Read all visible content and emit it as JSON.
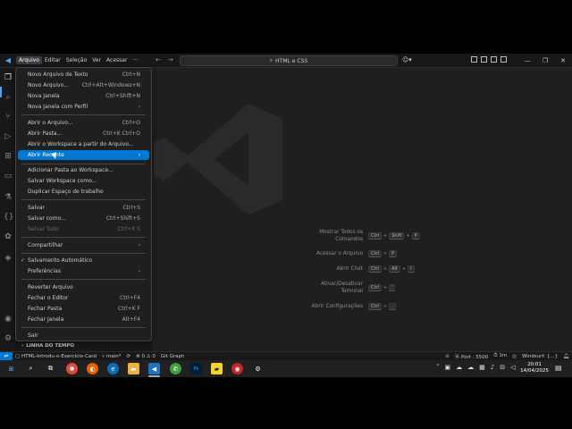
{
  "titlebar": {
    "menus": [
      "Arquivo",
      "Editar",
      "Seleção",
      "Ver",
      "Acessar",
      "···"
    ],
    "search_text": "HTML e CSS",
    "window_controls": [
      "—",
      "❐",
      "✕"
    ]
  },
  "dropdown": {
    "items": [
      {
        "label": "Novo Arquivo de Texto",
        "shortcut": "Ctrl+N"
      },
      {
        "label": "Novo Arquivo...",
        "shortcut": "Ctrl+Alt+Windows+N"
      },
      {
        "label": "Nova Janela",
        "shortcut": "Ctrl+Shift+N"
      },
      {
        "label": "Nova Janela com Perfil",
        "shortcut": ""
      },
      {
        "label": "Abrir o Arquivo...",
        "shortcut": "Ctrl+O"
      },
      {
        "label": "Abrir Pasta...",
        "shortcut": "Ctrl+K Ctrl+O"
      },
      {
        "label": "Abrir o Workspace a partir do Arquivo...",
        "shortcut": ""
      },
      {
        "label": "Abrir Recente",
        "shortcut": ""
      },
      {
        "label": "Adicionar Pasta ao Workspace...",
        "shortcut": ""
      },
      {
        "label": "Salvar Workspace como...",
        "shortcut": ""
      },
      {
        "label": "Duplicar Espaço de trabalho",
        "shortcut": ""
      },
      {
        "label": "Salvar",
        "shortcut": "Ctrl+S"
      },
      {
        "label": "Salvar como...",
        "shortcut": "Ctrl+Shift+S"
      },
      {
        "label": "Salvar Tudo",
        "shortcut": "Ctrl+K S"
      },
      {
        "label": "Compartilhar",
        "shortcut": ""
      },
      {
        "label": "Salvamento Automático",
        "shortcut": ""
      },
      {
        "label": "Preferências",
        "shortcut": ""
      },
      {
        "label": "Reverter Arquivo",
        "shortcut": ""
      },
      {
        "label": "Fechar o Editor",
        "shortcut": "Ctrl+F4"
      },
      {
        "label": "Fechar Pasta",
        "shortcut": "Ctrl+K F"
      },
      {
        "label": "Fechar Janela",
        "shortcut": "Alt+F4"
      },
      {
        "label": "Sair",
        "shortcut": ""
      }
    ]
  },
  "sidebar": {
    "timeline_label": "LINHA DO TEMPO"
  },
  "editor": {
    "shortcuts": [
      {
        "label_1": "Mostrar Todos os",
        "label_2": "Comandos",
        "keys": [
          "Ctrl",
          "Shift",
          "P"
        ]
      },
      {
        "label_1": "Acessar o Arquivo",
        "label_2": "",
        "keys": [
          "Ctrl",
          "P"
        ]
      },
      {
        "label_1": "Abrir Chat",
        "label_2": "",
        "keys": [
          "Ctrl",
          "Alt",
          "I"
        ]
      },
      {
        "label_1": "Ativar/Desativar",
        "label_2": "Terminal",
        "keys": [
          "Ctrl",
          "'"
        ]
      },
      {
        "label_1": "Abrir Configurações",
        "label_2": "",
        "keys": [
          "Ctrl",
          ","
        ]
      }
    ]
  },
  "statusbar": {
    "branch_file": "HTML-Introdu-o-Exercicio-Card",
    "branch": "main*",
    "errors": "0",
    "warnings": "0",
    "git_graph": "Git Graph",
    "port": "Port : 5500",
    "time_spent": "1m",
    "windsurf": "Windsurf: {...}"
  },
  "taskbar": {
    "time": "20:01",
    "date": "14/04/2025"
  },
  "colors": {
    "accent": "#0078d4",
    "background": "#1f1f1f",
    "sidebar": "#181818"
  }
}
